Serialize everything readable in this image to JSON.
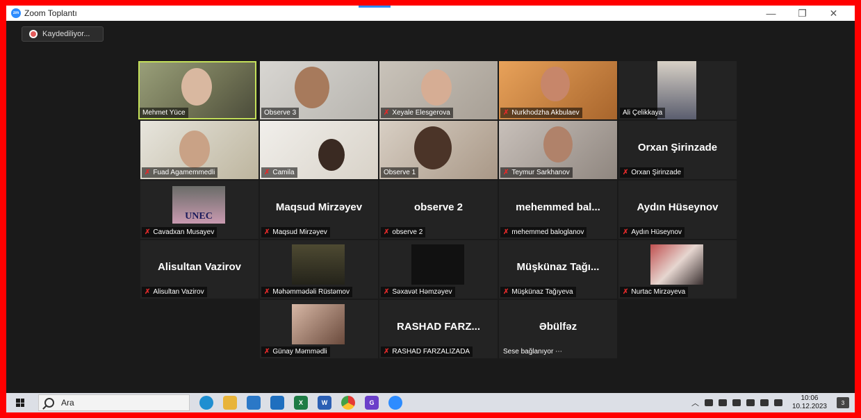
{
  "window": {
    "title": "Zoom Toplantı",
    "minimize": "—",
    "restore": "❐",
    "close": "✕"
  },
  "recording": {
    "label": "Kaydediliyor..."
  },
  "participants": [
    {
      "name": "Mehmet Yüce",
      "muted": false,
      "video": true,
      "active": true
    },
    {
      "name": "Observe 3",
      "muted": false,
      "video": true
    },
    {
      "name": "Xeyale Elesgerova",
      "muted": true,
      "video": true
    },
    {
      "name": "Nurkhodzha Akbulaev",
      "muted": true,
      "video": true
    },
    {
      "name": "Ali Çelikkaya",
      "muted": false,
      "video": true
    },
    {
      "name": "Fuad Agamemmedli",
      "muted": true,
      "video": true
    },
    {
      "name": "Camila",
      "muted": true,
      "video": true
    },
    {
      "name": "Observe 1",
      "muted": false,
      "video": true
    },
    {
      "name": "Teymur Sarkhanov",
      "muted": true,
      "video": true
    },
    {
      "name": "Orxan Şirinzade",
      "display": "Orxan Şirinzade",
      "muted": true,
      "video": false
    },
    {
      "name": "Cavadxan Musayev",
      "muted": true,
      "video": true,
      "sign_text": "UNEC"
    },
    {
      "name": "Maqsud Mirzəyev",
      "display": "Maqsud Mirzəyev",
      "muted": true,
      "video": false
    },
    {
      "name": "observe 2",
      "display": "observe 2",
      "muted": true,
      "video": false
    },
    {
      "name": "mehemmed baloglanov",
      "display": "mehemmed bal...",
      "muted": true,
      "video": false
    },
    {
      "name": "Aydın Hüseynov",
      "display": "Aydın Hüseynov",
      "muted": true,
      "video": false
    },
    {
      "name": "Alisultan Vazirov",
      "display": "Alisultan Vazirov",
      "muted": true,
      "video": false
    },
    {
      "name": "Məhəmmədəli Rüstəmov",
      "muted": true,
      "video": true
    },
    {
      "name": "Səxavət Həmzəyev",
      "muted": true,
      "video": true
    },
    {
      "name": "Müşkünaz Tağıyeva",
      "display": "Müşkünaz Tağı...",
      "muted": true,
      "video": false
    },
    {
      "name": "Nurtac Mirzəyeva",
      "muted": true,
      "video": true
    },
    {
      "name": "Günay Məmmədli",
      "muted": true,
      "video": true
    },
    {
      "name": "RASHAD FARZALIZADA",
      "display": "RASHAD FARZ...",
      "muted": true,
      "video": false
    },
    {
      "name": "Sese bağlanıyor ⋯",
      "display": "Əbülfəz",
      "muted": false,
      "video": false
    }
  ],
  "taskbar": {
    "search_placeholder": "Ara",
    "apps": [
      "edge-icon",
      "file-explorer-icon",
      "store-icon",
      "mail-icon",
      "excel-icon",
      "word-icon",
      "chrome-icon",
      "app-icon",
      "zoom-icon"
    ],
    "time": "10:06",
    "date": "10.12.2023",
    "notifications": "3"
  }
}
